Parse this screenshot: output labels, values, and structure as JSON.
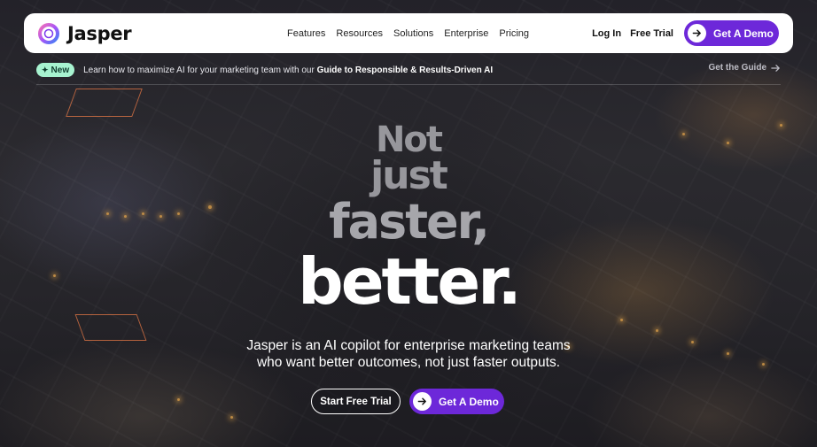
{
  "brand": {
    "name": "Jasper",
    "accent": "#6d28d9"
  },
  "nav": {
    "menu": [
      "Features",
      "Resources",
      "Solutions",
      "Enterprise",
      "Pricing"
    ],
    "login": "Log In",
    "free_trial": "Free Trial",
    "demo": "Get A Demo"
  },
  "announcement": {
    "badge": "New",
    "text_prefix": "Learn how to maximize AI for your marketing team with our ",
    "text_bold": "Guide to Responsible & Results-Driven AI",
    "link": "Get the Guide"
  },
  "hero": {
    "line1": "Not",
    "line2": "just",
    "line3": "faster,",
    "line4": "better.",
    "subtitle_line1": "Jasper is an AI copilot for enterprise marketing teams",
    "subtitle_line2": "who want better outcomes, not just faster outputs.",
    "cta_trial": "Start Free Trial",
    "cta_demo": "Get A Demo"
  },
  "icons": {
    "logo": "jasper-logo-icon",
    "arrow": "arrow-right-icon",
    "sparkle": "sparkle-icon"
  }
}
